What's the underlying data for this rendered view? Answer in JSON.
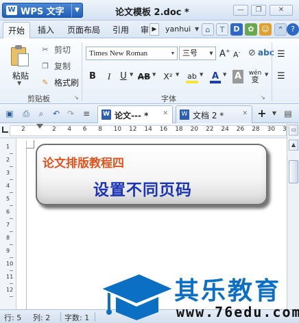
{
  "titlebar": {
    "app_menu_label": "WPS 文字",
    "app_logo_letter": "W",
    "document_title": "论文模板 2.doc *",
    "minimize_label": "—",
    "restore_label": "❐",
    "close_label": "✕"
  },
  "menu_tabs": {
    "items": [
      "开始",
      "插入",
      "页面布局",
      "引用",
      "审"
    ],
    "username": "yanhui"
  },
  "ribbon": {
    "clipboard": {
      "paste_label": "粘贴",
      "cut_label": "剪切",
      "copy_label": "复制",
      "format_painter_label": "格式刷",
      "group_label": "剪贴板"
    },
    "font": {
      "font_name": "Times New Roman",
      "font_size": "三号",
      "bold": "B",
      "italic": "I",
      "underline": "U",
      "strikethrough": "AB",
      "superscript": "X²",
      "highlight": "ab",
      "font_color": "A",
      "char_shading": "A",
      "phonetic": "wén",
      "group_label": "字体"
    }
  },
  "doc_tabs": [
    {
      "label": "论文--- *"
    },
    {
      "label": "文档 2 *"
    }
  ],
  "ruler": {
    "numbers": [
      "2",
      "2",
      "4",
      "6",
      "8",
      "10",
      "12",
      "14",
      "16",
      "18",
      "20",
      "22",
      "24",
      "26",
      "28",
      "30",
      "32"
    ],
    "vertical_numbers": [
      "1",
      "2",
      "3",
      "4",
      "5",
      "6",
      "7",
      "8",
      "9",
      "10",
      "11",
      "12"
    ]
  },
  "callout": {
    "subtitle": "论文排版教程四",
    "title": "设置不同页码"
  },
  "statusbar": {
    "line": "行: 5",
    "column": "列: 2",
    "word_count": "字数: 1"
  },
  "watermark": {
    "name": "其乐教育",
    "url": "www.76edu.com"
  },
  "colors": {
    "callout_subtitle": "#e0551f",
    "callout_title": "#1a33b8",
    "watermark_blue": "#0b6fc4"
  }
}
